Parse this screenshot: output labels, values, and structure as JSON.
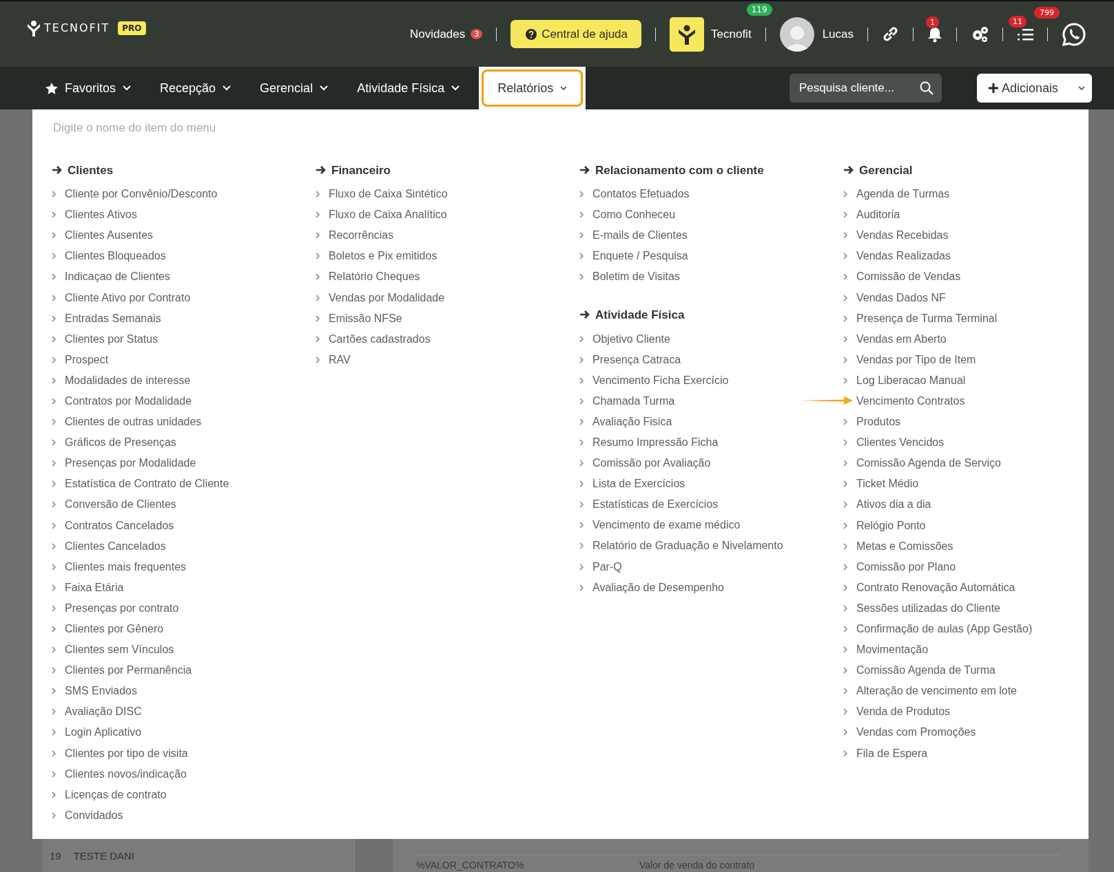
{
  "header": {
    "logo": "TECNOFIT",
    "plan": "PRO",
    "news": {
      "label": "Novidades",
      "count": "3"
    },
    "help": "Central de ajuda",
    "unit": {
      "name": "Tecnofit",
      "count": "119"
    },
    "user": "Lucas",
    "notifications": "1",
    "tasks": "11",
    "messages": "799"
  },
  "nav": {
    "items": [
      {
        "label": "Favoritos",
        "kind": "favorites",
        "selected": false
      },
      {
        "label": "Recepção",
        "kind": "menu",
        "selected": false
      },
      {
        "label": "Gerencial",
        "kind": "menu",
        "selected": false
      },
      {
        "label": "Atividade Física",
        "kind": "menu",
        "selected": false
      },
      {
        "label": "Relatórios",
        "kind": "menu",
        "selected": true
      }
    ],
    "search": {
      "placeholder": "Pesquisa cliente..."
    },
    "add_button": "Adicionais"
  },
  "menu": {
    "search": {
      "placeholder": "Digite o nome do item do menu"
    },
    "columns": [
      {
        "sections": [
          {
            "title": "Clientes",
            "items": [
              {
                "label": "Cliente por Convênio/Desconto",
                "pointed": false
              },
              {
                "label": "Clientes Ativos",
                "pointed": false
              },
              {
                "label": "Clientes Ausentes",
                "pointed": false
              },
              {
                "label": "Clientes Bloqueados",
                "pointed": false
              },
              {
                "label": "Indicaçao de Clientes",
                "pointed": false
              },
              {
                "label": "Cliente Ativo por Contrato",
                "pointed": false
              },
              {
                "label": "Entradas Semanais",
                "pointed": false
              },
              {
                "label": "Clientes por Status",
                "pointed": false
              },
              {
                "label": "Prospect",
                "pointed": false
              },
              {
                "label": "Modalidades de interesse",
                "pointed": false
              },
              {
                "label": "Contratos por Modalidade",
                "pointed": false
              },
              {
                "label": "Clientes de outras unidades",
                "pointed": false
              },
              {
                "label": "Gráficos de Presenças",
                "pointed": false
              },
              {
                "label": "Presenças por Modalidade",
                "pointed": false
              },
              {
                "label": "Estatística de Contrato de Cliente",
                "pointed": false
              },
              {
                "label": "Conversão de Clientes",
                "pointed": false
              },
              {
                "label": "Contratos Cancelados",
                "pointed": false
              },
              {
                "label": "Clientes Cancelados",
                "pointed": false
              },
              {
                "label": "Clientes mais frequentes",
                "pointed": false
              },
              {
                "label": "Faixa Etária",
                "pointed": false
              },
              {
                "label": "Presenças por contrato",
                "pointed": false
              },
              {
                "label": "Clientes por Gênero",
                "pointed": false
              },
              {
                "label": "Clientes sem Vínculos",
                "pointed": false
              },
              {
                "label": "Clientes por Permanência",
                "pointed": false
              },
              {
                "label": "SMS Enviados",
                "pointed": false
              },
              {
                "label": "Avaliação DISC",
                "pointed": false
              },
              {
                "label": "Login Aplicativo",
                "pointed": false
              },
              {
                "label": "Clientes por tipo de visita",
                "pointed": false
              },
              {
                "label": "Clientes novos/indicação",
                "pointed": false
              },
              {
                "label": "Licenças de contrato",
                "pointed": false
              },
              {
                "label": "Convidados",
                "pointed": false
              }
            ]
          }
        ]
      },
      {
        "sections": [
          {
            "title": "Financeiro",
            "items": [
              {
                "label": "Fluxo de Caixa Sintético",
                "pointed": false
              },
              {
                "label": "Fluxo de Caixa Analítico",
                "pointed": false
              },
              {
                "label": "Recorrências",
                "pointed": false
              },
              {
                "label": "Boletos e Pix emitidos",
                "pointed": false
              },
              {
                "label": "Relatório Cheques",
                "pointed": false
              },
              {
                "label": "Vendas por Modalidade",
                "pointed": false
              },
              {
                "label": "Emissão NFSe",
                "pointed": false
              },
              {
                "label": "Cartões cadastrados",
                "pointed": false
              },
              {
                "label": "RAV",
                "pointed": false
              }
            ]
          }
        ]
      },
      {
        "sections": [
          {
            "title": "Relacionamento com o cliente",
            "items": [
              {
                "label": "Contatos Efetuados",
                "pointed": false
              },
              {
                "label": "Como Conheceu",
                "pointed": false
              },
              {
                "label": "E-mails de Clientes",
                "pointed": false
              },
              {
                "label": "Enquete / Pesquisa",
                "pointed": false
              },
              {
                "label": "Boletim de Visitas",
                "pointed": false
              }
            ]
          },
          {
            "title": "Atividade Física",
            "items": [
              {
                "label": "Objetivo Cliente",
                "pointed": false
              },
              {
                "label": "Presença Catraca",
                "pointed": false
              },
              {
                "label": "Vencimento Ficha Exercício",
                "pointed": false
              },
              {
                "label": "Chamada Turma",
                "pointed": false
              },
              {
                "label": "Avaliação Fisica",
                "pointed": false
              },
              {
                "label": "Resumo Impressão Ficha",
                "pointed": false
              },
              {
                "label": "Comissão por Avaliação",
                "pointed": false
              },
              {
                "label": "Lista de Exercícios",
                "pointed": false
              },
              {
                "label": "Estatísticas de Exercícios",
                "pointed": false
              },
              {
                "label": "Vencimento de exame médico",
                "pointed": false
              },
              {
                "label": "Relatório de Graduação e Nivelamento",
                "pointed": false
              },
              {
                "label": "Par-Q",
                "pointed": false
              },
              {
                "label": "Avaliação de Desempenho",
                "pointed": false
              }
            ]
          }
        ]
      },
      {
        "sections": [
          {
            "title": "Gerencial",
            "items": [
              {
                "label": "Agenda de Turmas",
                "pointed": false
              },
              {
                "label": "Auditoria",
                "pointed": false
              },
              {
                "label": "Vendas Recebidas",
                "pointed": false
              },
              {
                "label": "Vendas Realizadas",
                "pointed": false
              },
              {
                "label": "Comissão de Vendas",
                "pointed": false
              },
              {
                "label": "Vendas Dados NF",
                "pointed": false
              },
              {
                "label": "Presença de Turma Terminal",
                "pointed": false
              },
              {
                "label": "Vendas em Aberto",
                "pointed": false
              },
              {
                "label": "Vendas por Tipo de Item",
                "pointed": false
              },
              {
                "label": "Log Liberacao Manual",
                "pointed": false
              },
              {
                "label": "Vencimento Contratos",
                "pointed": true
              },
              {
                "label": "Produtos",
                "pointed": false
              },
              {
                "label": "Clientes Vencidos",
                "pointed": false
              },
              {
                "label": "Comissão Agenda de Serviço",
                "pointed": false
              },
              {
                "label": "Ticket Médio",
                "pointed": false
              },
              {
                "label": "Ativos dia a dia",
                "pointed": false
              },
              {
                "label": "Relógio Ponto",
                "pointed": false
              },
              {
                "label": "Metas e Comissões",
                "pointed": false
              },
              {
                "label": "Comissão por Plano",
                "pointed": false
              },
              {
                "label": "Contrato Renovação Automática",
                "pointed": false
              },
              {
                "label": "Sessões utilizadas do Cliente",
                "pointed": false
              },
              {
                "label": "Confirmação de aulas (App Gestão)",
                "pointed": false
              },
              {
                "label": "Movimentação",
                "pointed": false
              },
              {
                "label": "Comissão Agenda de Turma",
                "pointed": false
              },
              {
                "label": "Alteração de vencimento em lote",
                "pointed": false
              },
              {
                "label": "Venda de Produtos",
                "pointed": false
              },
              {
                "label": "Vendas com Promoções",
                "pointed": false
              },
              {
                "label": "Fila de Espera",
                "pointed": false
              }
            ]
          }
        ]
      }
    ]
  },
  "background": {
    "list_row": {
      "number": "19",
      "name": "TESTE DANI"
    },
    "variable_row": {
      "variable": "%VALOR_CONTRATO%",
      "description": "Valor de venda do contrato"
    }
  }
}
